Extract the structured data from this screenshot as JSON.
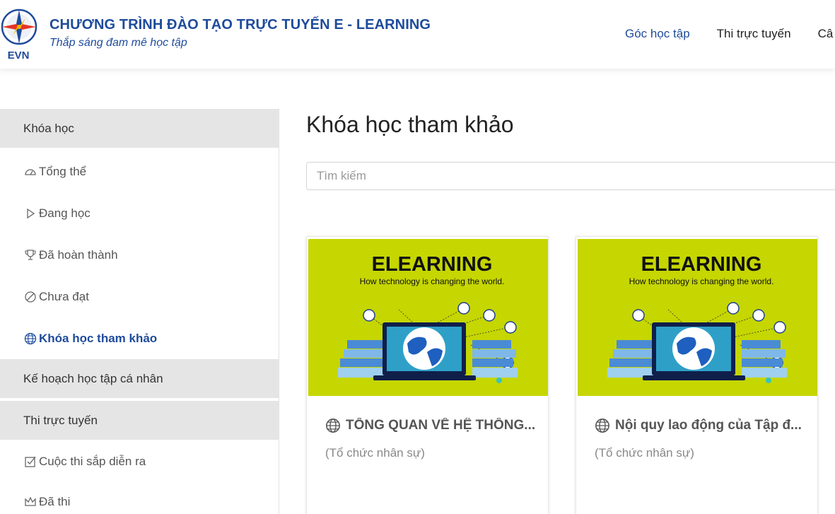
{
  "header": {
    "logo_text": "EVN",
    "title": "CHƯƠNG TRÌNH ĐÀO TẠO TRỰC TUYẾN E - LEARNING",
    "slogan": "Thắp sáng đam mê học tập",
    "nav": [
      "Góc học tập",
      "Thi trực tuyến",
      "Câ"
    ]
  },
  "sidebar": {
    "section_courses": "Khóa học",
    "items": [
      {
        "label": "Tổng thể",
        "icon": "dashboard-icon"
      },
      {
        "label": "Đang học",
        "icon": "play-icon"
      },
      {
        "label": "Đã hoàn thành",
        "icon": "trophy-icon"
      },
      {
        "label": "Chưa đạt",
        "icon": "ban-icon"
      },
      {
        "label": "Khóa học tham khảo",
        "icon": "globe-icon",
        "active": true
      }
    ],
    "section_plan": "Kế hoạch học tập cá nhân",
    "section_exam": "Thi trực tuyến",
    "exam_items": [
      {
        "label": "Cuộc thi sắp diễn ra",
        "icon": "checkbox-icon"
      },
      {
        "label": "Đã thi",
        "icon": "crown-icon"
      }
    ]
  },
  "main": {
    "title": "Khóa học tham khảo",
    "search_placeholder": "Tìm kiếm",
    "cards": [
      {
        "image_heading": "ELEARNING",
        "image_sub": "How technology is changing the world.",
        "title": "TỔNG QUAN VỀ HỆ THỐNG...",
        "org": "(Tổ chức nhân sự)"
      },
      {
        "image_heading": "ELEARNING",
        "image_sub": "How technology is changing the world.",
        "title": "Nội quy lao động của Tập đ...",
        "org": "(Tổ chức nhân sự)"
      }
    ]
  },
  "colors": {
    "brand_blue": "#1e4b9b",
    "card_image_bg": "#c5d600",
    "sidebar_section_bg": "#e5e5e5"
  }
}
